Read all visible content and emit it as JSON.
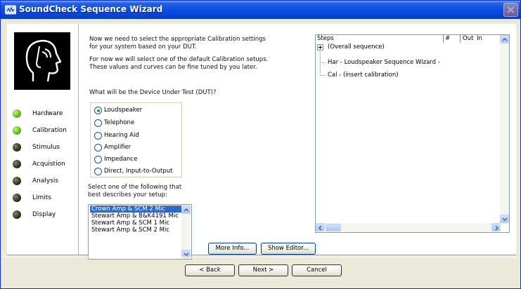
{
  "window": {
    "title": "SoundCheck Sequence Wizard",
    "title_icon": "soundcheck-app-icon",
    "close_icon": "close-icon"
  },
  "intro": {
    "line1": "Now we need to select the appropriate Calibration settings",
    "line2": "for your system based on your DUT.",
    "line3": "For now we will select one of the default Calibration setups.",
    "line4": "These values and curves can be fine tuned by you later."
  },
  "dut": {
    "question": "What will be the Device Under Test (DUT)?",
    "options": [
      {
        "label": "Loudspeaker",
        "selected": true
      },
      {
        "label": "Telephone",
        "selected": false
      },
      {
        "label": "Hearing Aid",
        "selected": false
      },
      {
        "label": "Amplifier",
        "selected": false
      },
      {
        "label": "Impedance",
        "selected": false
      },
      {
        "label": "Direct, Input-to-Output",
        "selected": false
      }
    ]
  },
  "wizard_steps": [
    {
      "label": "Hardware",
      "state": "done",
      "color": "#6fc02a"
    },
    {
      "label": "Calibration",
      "state": "current",
      "color": "#6fc02a"
    },
    {
      "label": "Stimulus",
      "state": "pending",
      "color": "#2d3a20"
    },
    {
      "label": "Acquistion",
      "state": "pending",
      "color": "#2d3a20"
    },
    {
      "label": "Analysis",
      "state": "pending",
      "color": "#2d3a20"
    },
    {
      "label": "Limits",
      "state": "pending",
      "color": "#2d3a20"
    },
    {
      "label": "Display",
      "state": "pending",
      "color": "#2d3a20"
    }
  ],
  "setup": {
    "prompt_line1": "Select one of the following that",
    "prompt_line2": "best describes your setup:",
    "items": [
      {
        "label": "Crown Amp & SCM 2 Mic",
        "selected": true
      },
      {
        "label": "Stewart Amp & B&K4191 Mic",
        "selected": false
      },
      {
        "label": "Stewart Amp & SCM 1 Mic",
        "selected": false
      },
      {
        "label": "Stewart Amp & SCM 2 Mic",
        "selected": false
      }
    ]
  },
  "buttons": {
    "more_info": "More Info...",
    "show_editor": "Show Editor...",
    "back": "< Back",
    "next": "Next >",
    "cancel": "Cancel"
  },
  "steps_pane": {
    "headers": {
      "steps": "Steps",
      "num": "#",
      "out": "Out",
      "in": "In"
    },
    "rows": [
      "(Overall sequence)",
      "Har - Loudspeaker Sequence Wizard -",
      "Cal - (insert calibration)"
    ]
  }
}
